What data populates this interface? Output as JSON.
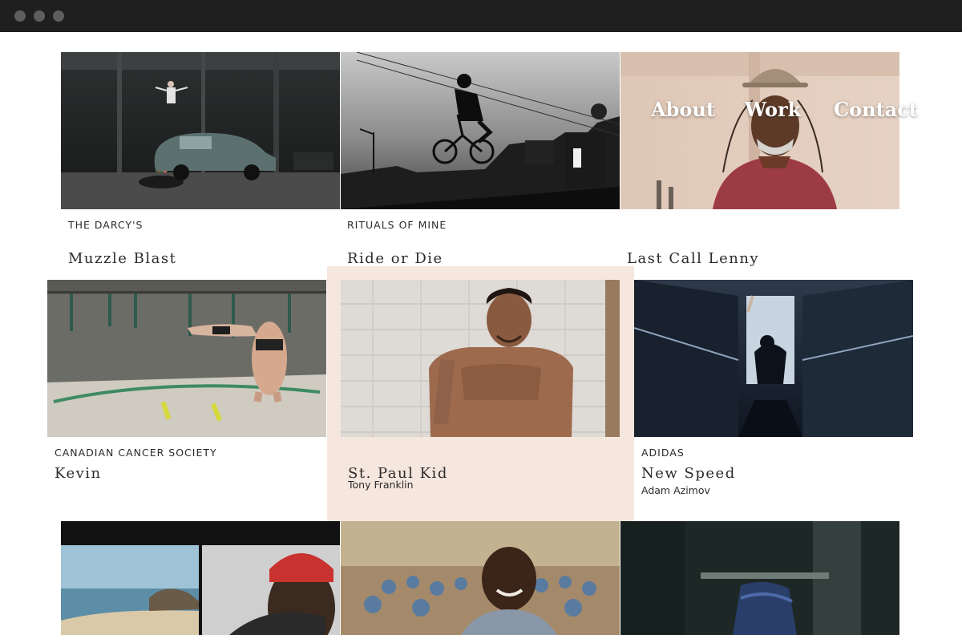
{
  "browser": {
    "controls": [
      "close",
      "minimize",
      "maximize"
    ]
  },
  "nav": {
    "about": "About",
    "work": "Work",
    "contact": "Contact"
  },
  "projects": [
    {
      "client": "THE DARCY'S",
      "title": "Muzzle Blast"
    },
    {
      "client": "RITUALS OF MINE",
      "title": "Ride or Die"
    },
    {
      "client": "",
      "title": "Last Call Lenny"
    },
    {
      "client": "CANADIAN CANCER SOCIETY",
      "title": "Kevin"
    },
    {
      "client": "",
      "title": "St. Paul Kid",
      "director": "Tony Franklin"
    },
    {
      "client": "ADIDAS",
      "title": "New Speed",
      "director": "Adam Azimov"
    }
  ],
  "colors": {
    "chrome": "#1f1f1f",
    "active_tile": "#f5e6de",
    "text": "#2b2b2b"
  }
}
